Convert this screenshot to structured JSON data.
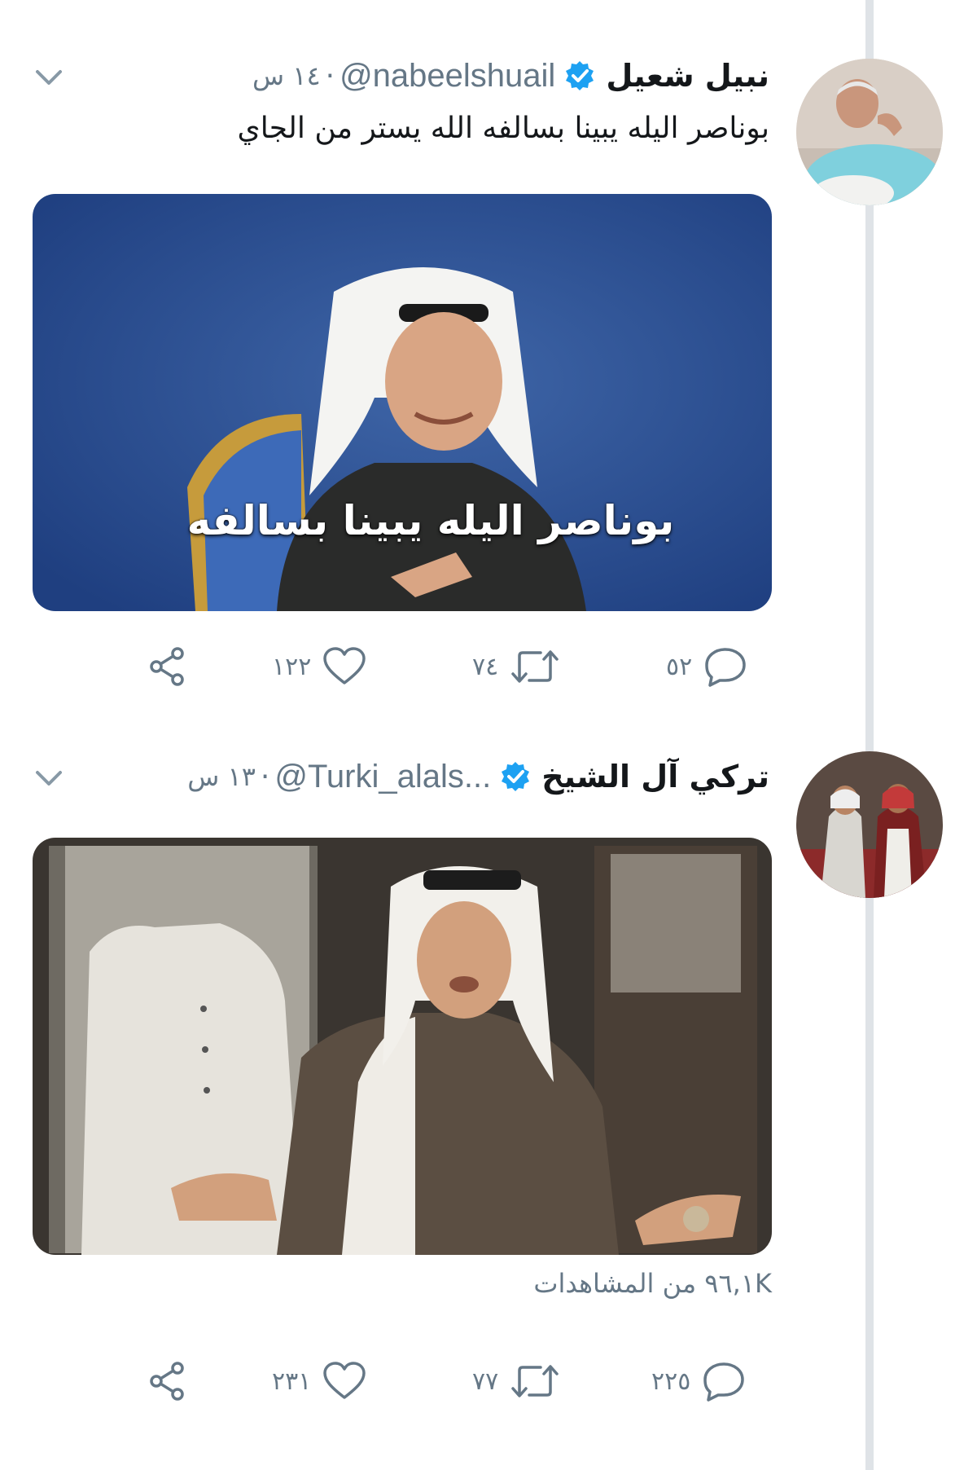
{
  "tweets": [
    {
      "display_name": "نبيل شعيل",
      "handle": "@nabeelshuail",
      "separator": "·",
      "time": "١٤ س",
      "text": "بوناصر اليله يبينا بسالفه الله يستر من الجاي",
      "media_caption": "بوناصر اليله يبينا بسالفه",
      "actions": {
        "replies": "٥٢",
        "retweets": "٧٤",
        "likes": "١٢٢"
      }
    },
    {
      "display_name": "تركي آل الشيخ",
      "handle": "@Turki_alals...",
      "separator": "·",
      "time": "١٣ س",
      "views": "٩٦,١K من المشاهدات",
      "actions": {
        "replies": "٢٢٥",
        "retweets": "٧٧",
        "likes": "٢٣١"
      }
    }
  ],
  "colors": {
    "text_primary": "#14171a",
    "text_secondary": "#657786",
    "verified": "#1da1f2",
    "thread_line": "#dfe3e7"
  },
  "icons": {
    "verified": "verified-badge-icon",
    "caret": "chevron-down-icon",
    "reply": "reply-icon",
    "retweet": "retweet-icon",
    "like": "heart-icon",
    "share": "share-icon"
  }
}
